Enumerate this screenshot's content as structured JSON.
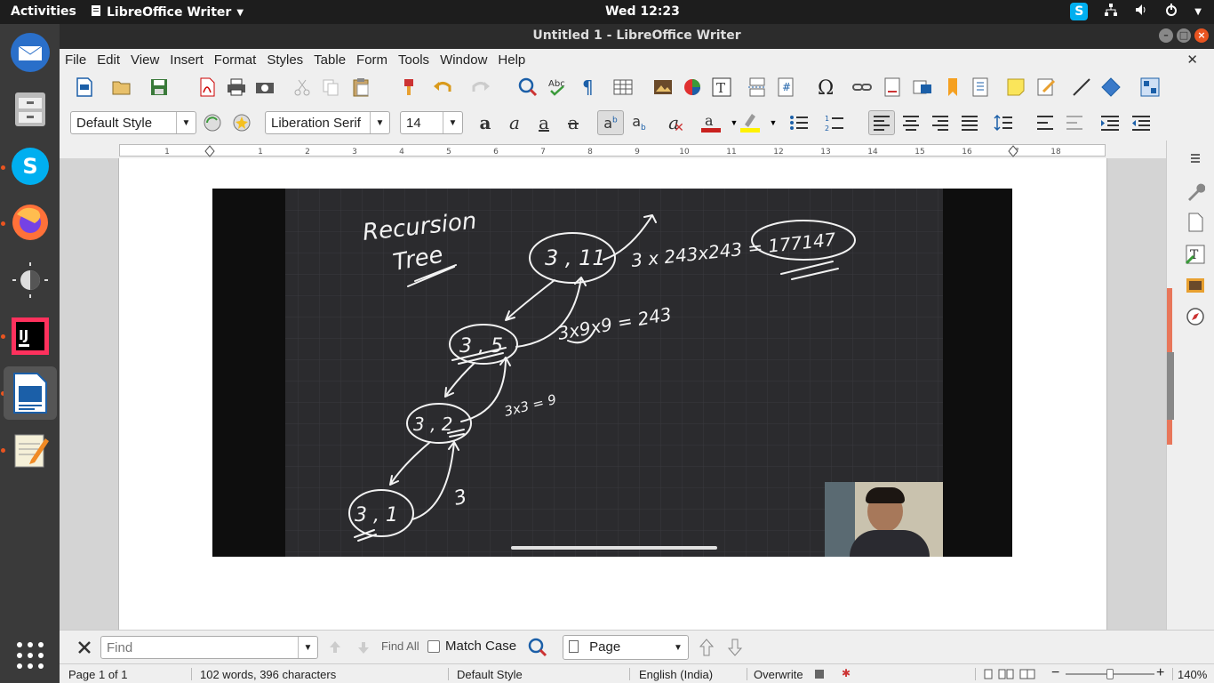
{
  "topbar": {
    "activities": "Activities",
    "app_name": "LibreOffice Writer",
    "clock": "Wed 12:23"
  },
  "window": {
    "title": "Untitled 1 - LibreOffice Writer"
  },
  "menubar": {
    "items": [
      "File",
      "Edit",
      "View",
      "Insert",
      "Format",
      "Styles",
      "Table",
      "Form",
      "Tools",
      "Window",
      "Help"
    ]
  },
  "formatting": {
    "paragraph_style": "Default Style",
    "font_name": "Liberation Serif",
    "font_size": "14"
  },
  "ruler": {
    "ticks": [
      "1",
      "1",
      "2",
      "3",
      "4",
      "5",
      "6",
      "7",
      "8",
      "9",
      "10",
      "11",
      "12",
      "13",
      "14",
      "15",
      "16",
      "17",
      "18"
    ]
  },
  "whiteboard": {
    "title_line1": "Recursion",
    "title_line2": "Tree",
    "node1": "3 , 11",
    "node2": "3 , 5",
    "node3": "3 , 2",
    "node4": "3 , 1",
    "eq1": "3 x 243x243 = 177147",
    "eq2": "3x9x9 = 243",
    "eq3": "3x3 = 9",
    "eq4": "3"
  },
  "findbar": {
    "find_placeholder": "Find",
    "find_all": "Find All",
    "match_case": "Match Case",
    "search_scope": "Page"
  },
  "statusbar": {
    "page": "Page 1 of 1",
    "word_count": "102 words, 396 characters",
    "page_style": "Default Style",
    "language": "English (India)",
    "insert_mode": "Overwrite",
    "zoom": "140%"
  },
  "colors": {
    "accent": "#e95420",
    "board_bg": "#2b2b2e",
    "dock_bg": "#3a3a3a"
  }
}
